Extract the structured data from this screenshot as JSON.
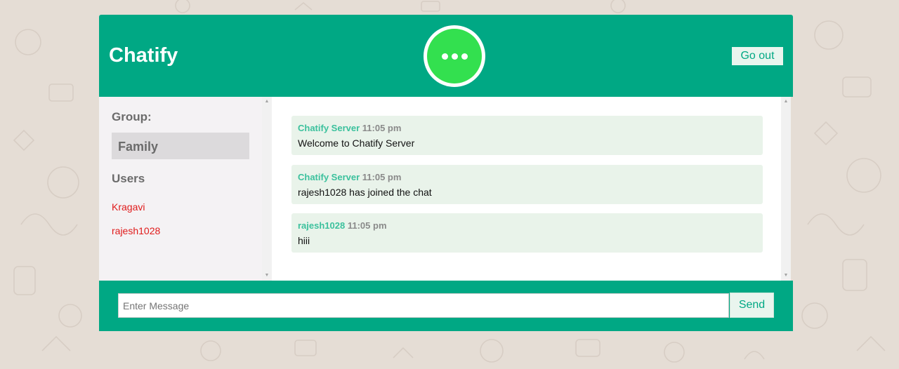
{
  "header": {
    "title": "Chatify",
    "avatar_icon": "more-dots-icon",
    "go_out_label": "Go out"
  },
  "sidebar": {
    "group_heading": "Group:",
    "group_name": "Family",
    "users_heading": "Users",
    "users": [
      "Kragavi",
      "rajesh1028"
    ]
  },
  "messages": [
    {
      "sender": "Chatify Server",
      "time": "11:05 pm",
      "text": "Welcome to Chatify Server"
    },
    {
      "sender": "Chatify Server",
      "time": "11:05 pm",
      "text": "rajesh1028 has joined the chat"
    },
    {
      "sender": "rajesh1028",
      "time": "11:05 pm",
      "text": "hiii"
    }
  ],
  "composer": {
    "placeholder": "Enter Message",
    "value": "",
    "send_label": "Send"
  },
  "colors": {
    "brand": "#00a884",
    "avatar": "#33e04f",
    "user_name": "#e01b1b",
    "sender_name": "#3cc19d",
    "message_bubble": "#e9f3ea",
    "page_background": "#e5ddd5"
  }
}
